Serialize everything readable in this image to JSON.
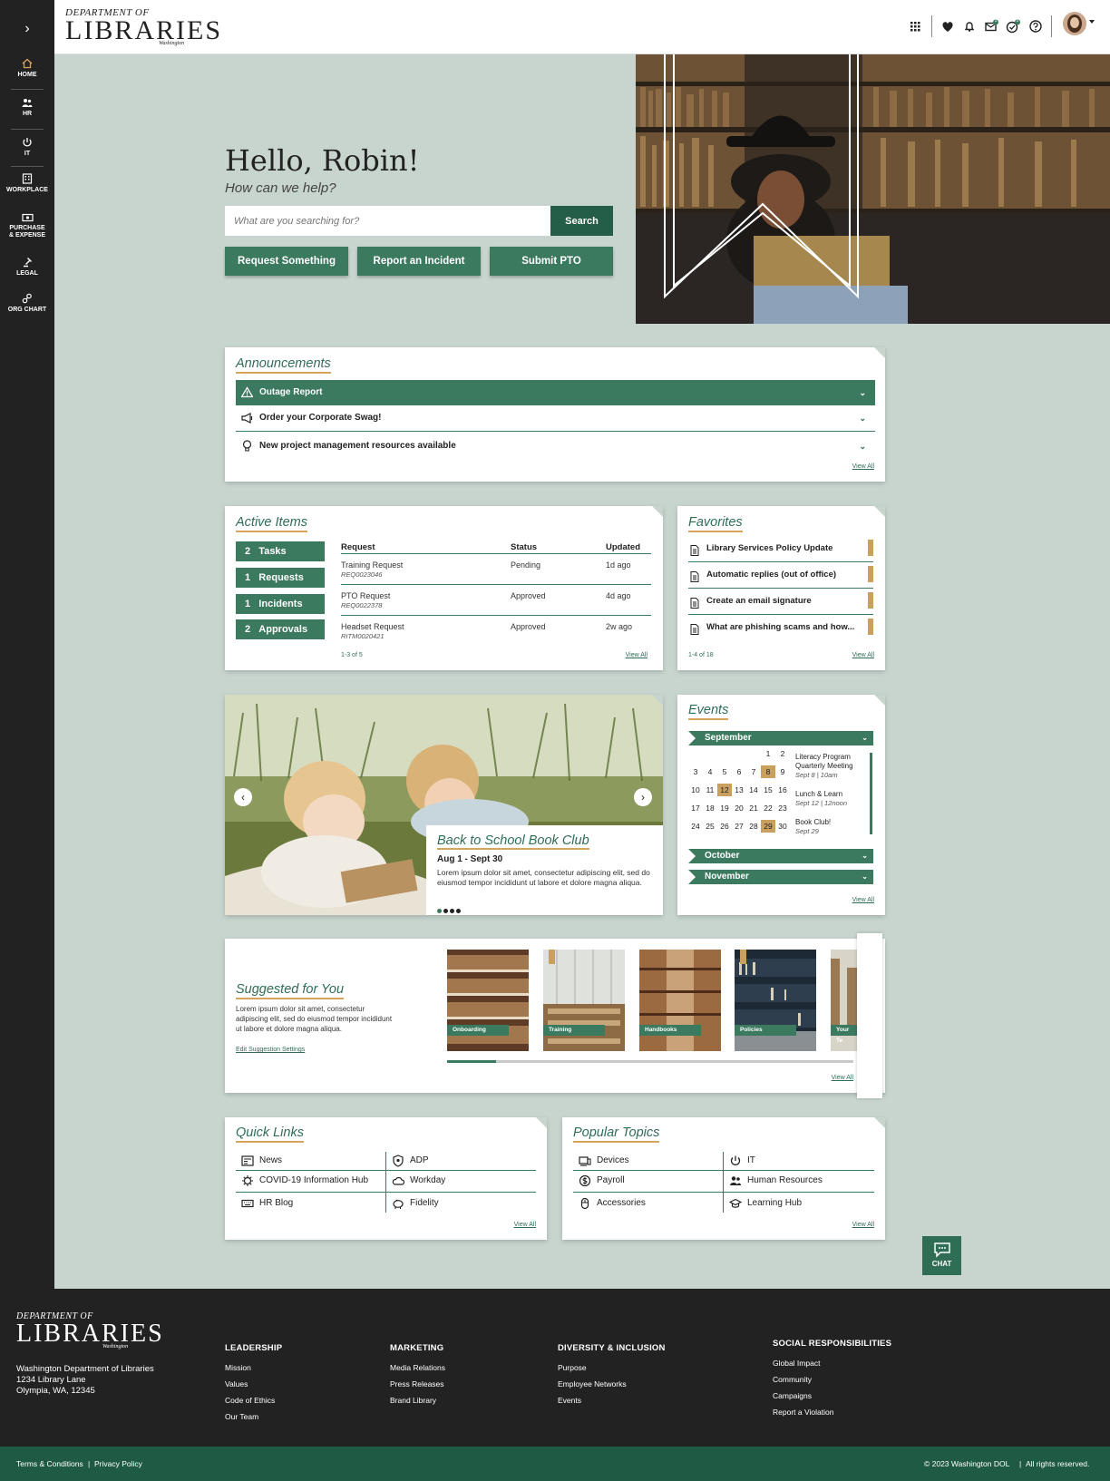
{
  "sidebar": {
    "items": [
      {
        "label": "HOME"
      },
      {
        "label": "HR"
      },
      {
        "label": "IT"
      },
      {
        "label": "WORKPLACE"
      },
      {
        "label": "PURCHASE\n& EXPENSE",
        "l1": "PURCHASE",
        "l2": "& EXPENSE"
      },
      {
        "label": "LEGAL"
      },
      {
        "label": "ORG CHART"
      }
    ],
    "toggle": "›"
  },
  "brand": {
    "dept": "DEPARTMENT OF",
    "name": "LIBRARIES",
    "state": "Washington"
  },
  "topbar": {
    "icons": [
      "apps-grid-icon",
      "heart-icon",
      "bell-icon",
      "mail-icon",
      "approvals-icon",
      "help-icon",
      "avatar"
    ],
    "mail_count": "1",
    "approvals_count": "2"
  },
  "hero": {
    "greeting": "Hello, Robin!",
    "subtitle": "How can we help?",
    "search_placeholder": "What are you searching for?",
    "search_button": "Search",
    "actions": [
      "Request Something",
      "Report an Incident",
      "Submit PTO"
    ]
  },
  "announcements": {
    "title": "Announcements",
    "items": [
      "Outage Report",
      "Order your Corporate Swag!",
      "New project management resources available"
    ],
    "view_all": "View All"
  },
  "active_items": {
    "title": "Active Items",
    "counters": [
      {
        "count": "2",
        "label": "Tasks"
      },
      {
        "count": "1",
        "label": "Requests"
      },
      {
        "count": "1",
        "label": "Incidents"
      },
      {
        "count": "2",
        "label": "Approvals"
      }
    ],
    "columns": [
      "Request",
      "Status",
      "Updated"
    ],
    "rows": [
      {
        "name": "Training Request",
        "id": "REQ0023046",
        "status": "Pending",
        "updated": "1d ago"
      },
      {
        "name": "PTO Request",
        "id": "REQ0022378",
        "status": "Approved",
        "updated": "4d ago"
      },
      {
        "name": "Headset Request",
        "id": "RITM0020421",
        "status": "Approved",
        "updated": "2w ago"
      }
    ],
    "pagination": "1-3 of 5",
    "view_all": "View All"
  },
  "favorites": {
    "title": "Favorites",
    "items": [
      "Library Services Policy Update",
      "Automatic replies (out of office)",
      "Create an email signature",
      "What are phishing scams and how..."
    ],
    "pagination": "1-4 of 18",
    "view_all": "View All"
  },
  "carousel": {
    "title": "Back to School Book Club",
    "dates": "Aug 1 - Sept 30",
    "body": "Lorem ipsum dolor sit amet, consectetur adipiscing elit, sed do eiusmod tempor incididunt ut labore et dolore magna aliqua.",
    "slides": 4,
    "active_slide": 1
  },
  "events": {
    "title": "Events",
    "months": [
      "September",
      "October",
      "November"
    ],
    "days": [
      "1",
      "2",
      "3",
      "4",
      "5",
      "6",
      "7",
      "8",
      "9",
      "10",
      "11",
      "12",
      "13",
      "14",
      "15",
      "16",
      "17",
      "18",
      "19",
      "20",
      "21",
      "22",
      "23",
      "24",
      "25",
      "26",
      "27",
      "28",
      "29",
      "30"
    ],
    "highlighted": [
      "8",
      "12",
      "29"
    ],
    "list": [
      {
        "name": "Literacy Program Quarterly Meeting",
        "n1": "Literacy Program",
        "n2": "Quarterly Meeting",
        "when": "Sept 8 | 10am"
      },
      {
        "name": "Lunch & Learn",
        "when": "Sept 12 | 12noon"
      },
      {
        "name": "Book Club!",
        "when": "Sept 29"
      }
    ],
    "view_all": "View All"
  },
  "suggested": {
    "title": "Suggested for You",
    "body": "Lorem ipsum dolor sit amet, consectetur adipiscing elit, sed do eiusmod tempor incididunt ut labore et dolore magna aliqua.",
    "settings_link": "Edit Suggestion Settings",
    "tiles": [
      "Onboarding",
      "Training",
      "Handbooks",
      "Policies",
      "Your Te"
    ],
    "scroll_progress": 0.12,
    "view_all": "View All"
  },
  "quick_links": {
    "title": "Quick Links",
    "left": [
      "News",
      "COVID-19 Information Hub",
      "HR Blog"
    ],
    "right": [
      "ADP",
      "Workday",
      "Fidelity"
    ],
    "view_all": "View All"
  },
  "popular_topics": {
    "title": "Popular Topics",
    "left": [
      "Devices",
      "Payroll",
      "Accessories"
    ],
    "right": [
      "IT",
      "Human Resources",
      "Learning Hub"
    ],
    "view_all": "View All"
  },
  "chat": {
    "label": "CHAT"
  },
  "footer": {
    "address": [
      "Washington Department of Libraries",
      "1234 Library Lane",
      "Olympia, WA, 12345"
    ],
    "columns": [
      {
        "heading": "LEADERSHIP",
        "links": [
          "Mission",
          "Values",
          "Code of Ethics",
          "Our Team"
        ]
      },
      {
        "heading": "MARKETING",
        "links": [
          "Media Relations",
          "Press Releases",
          "Brand Library"
        ]
      },
      {
        "heading": "DIVERSITY & INCLUSION",
        "links": [
          "Purpose",
          "Employee Networks",
          "Events"
        ]
      },
      {
        "heading": "SOCIAL RESPONSIBILITIES",
        "links": [
          "Global Impact",
          "Community",
          "Campaigns",
          "Report a Violation"
        ]
      }
    ],
    "legal": [
      "Terms & Conditions",
      "Privacy Policy"
    ],
    "separator": "|",
    "copyright": "© 2023 Washington DOL",
    "rights": "All rights reserved."
  },
  "colors": {
    "accent": "#2f6e55",
    "dark_green": "#1f5a44",
    "gold": "#c9a05c",
    "sage": "#c8d5cf",
    "dark": "#222222"
  }
}
